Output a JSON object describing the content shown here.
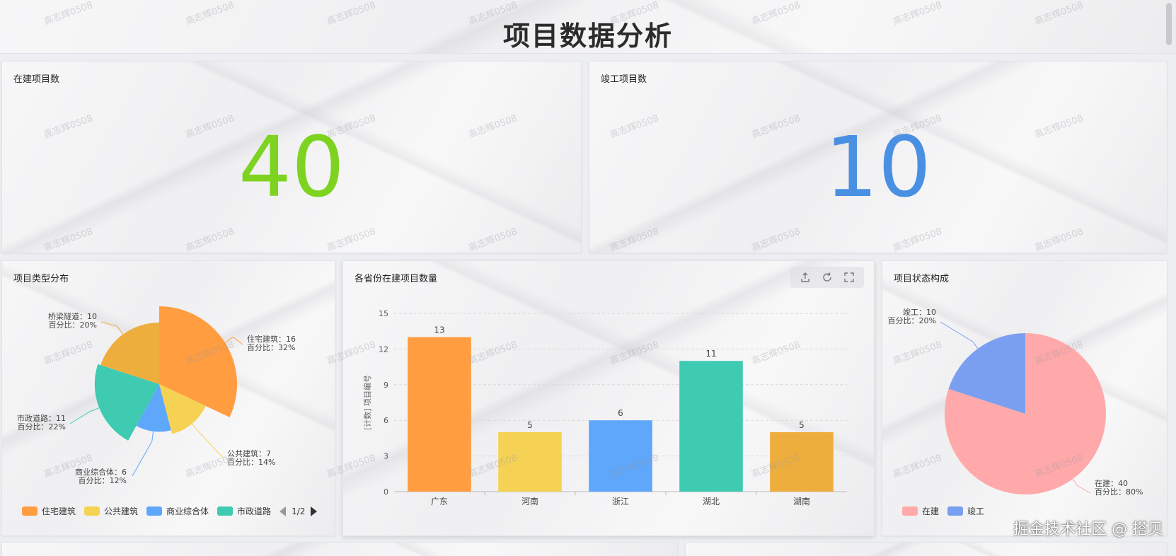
{
  "header": {
    "title": "项目数据分析"
  },
  "kpis": [
    {
      "title": "在建项目数",
      "value": "40",
      "color": "#7ed321"
    },
    {
      "title": "竣工项目数",
      "value": "10",
      "color": "#4a90e2"
    }
  ],
  "type_distribution": {
    "title": "项目类型分布",
    "legend": {
      "items": [
        "住宅建筑",
        "公共建筑",
        "商业综合体",
        "市政道路"
      ],
      "page": "1/2"
    },
    "chart_data": {
      "type": "pie",
      "variant": "rose",
      "slices": [
        {
          "name": "住宅建筑",
          "value": 16,
          "percent": "32%",
          "color": "#ff9d40"
        },
        {
          "name": "公共建筑",
          "value": 7,
          "percent": "14%",
          "color": "#f5d253"
        },
        {
          "name": "商业综合体",
          "value": 6,
          "percent": "12%",
          "color": "#5ea7fb"
        },
        {
          "name": "市政道路",
          "value": 11,
          "percent": "22%",
          "color": "#3fcab2"
        },
        {
          "name": "桥梁隧道",
          "value": 10,
          "percent": "20%",
          "color": "#eeae3e"
        }
      ],
      "label_prefix": "百分比："
    }
  },
  "province_bar": {
    "title": "各省份在建项目数量",
    "chart_data": {
      "type": "bar",
      "categories": [
        "广东",
        "河南",
        "浙江",
        "湖北",
        "湖南"
      ],
      "values": [
        13,
        5,
        6,
        11,
        5
      ],
      "colors": [
        "#ff9d40",
        "#f5d253",
        "#5ea7fb",
        "#3fcab2",
        "#eeae3e"
      ],
      "ylabel": "[计数] 项目编号",
      "ylim": [
        0,
        15
      ],
      "yticks": [
        "0",
        "3",
        "6",
        "9",
        "12",
        "15"
      ],
      "grid": true
    }
  },
  "status_pie": {
    "title": "项目状态构成",
    "legend": {
      "items": [
        "在建",
        "竣工"
      ]
    },
    "chart_data": {
      "type": "pie",
      "slices": [
        {
          "name": "在建",
          "value": 40,
          "percent": "80%",
          "color": "#ffa9aa"
        },
        {
          "name": "竣工",
          "value": 10,
          "percent": "20%",
          "color": "#7b9ff0"
        }
      ],
      "label_prefix": "百分比："
    }
  },
  "brand": {
    "text": "掘金技术社区 @ 搭贝"
  },
  "watermark": {
    "text": "高志辉0508"
  }
}
